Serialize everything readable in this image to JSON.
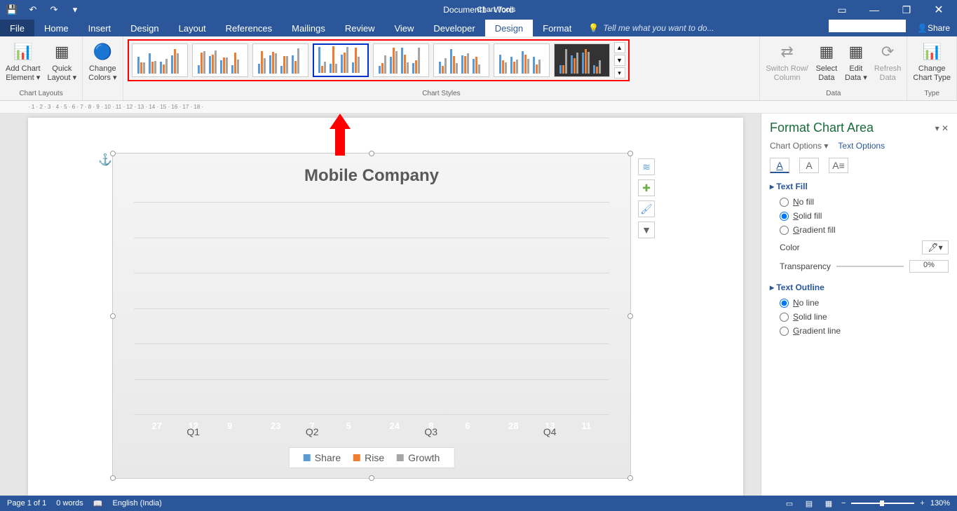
{
  "app": {
    "title": "Document1 - Word",
    "contextTab": "Chart Tools"
  },
  "qat": {
    "save": "💾",
    "undo": "↶",
    "redo": "↷",
    "more": "▾"
  },
  "windowBtns": {
    "ribbonOpts": "▭",
    "min": "—",
    "restore": "❐",
    "close": "✕"
  },
  "tabs": [
    "File",
    "Home",
    "Insert",
    "Design",
    "Layout",
    "References",
    "Mailings",
    "Review",
    "View",
    "Developer",
    "Design",
    "Format"
  ],
  "activeTab": 10,
  "tellme": "Tell me what you want to do...",
  "share": "Share",
  "ribbon": {
    "chartLayouts": {
      "label": "Chart Layouts",
      "addElement": "Add Chart\nElement ▾",
      "quickLayout": "Quick\nLayout ▾"
    },
    "changeColors": "Change\nColors ▾",
    "chartStyles": {
      "label": "Chart Styles"
    },
    "data": {
      "label": "Data",
      "switch": "Switch Row/\nColumn",
      "select": "Select\nData",
      "edit": "Edit\nData ▾",
      "refresh": "Refresh\nData"
    },
    "type": {
      "label": "Type",
      "change": "Change\nChart Type"
    }
  },
  "chart_data": {
    "type": "bar",
    "title": "Mobile Company",
    "categories": [
      "Q1",
      "Q2",
      "Q3",
      "Q4"
    ],
    "series": [
      {
        "name": "Share",
        "values": [
          27,
          23,
          24,
          28
        ]
      },
      {
        "name": "Rise",
        "values": [
          12,
          7,
          8,
          13
        ]
      },
      {
        "name": "Growth",
        "values": [
          9,
          5,
          6,
          11
        ]
      }
    ],
    "ylim": [
      0,
      30
    ]
  },
  "sideButtons": {
    "elements": "≋",
    "add": "✚",
    "style": "🖌",
    "filter": "▼"
  },
  "formatPane": {
    "title": "Format Chart Area",
    "tabChart": "Chart Options ▾",
    "tabText": "Text Options",
    "sectionFill": "Text Fill",
    "noFill": "No fill",
    "solidFill": "Solid fill",
    "gradientFill": "Gradient fill",
    "colorLabel": "Color",
    "transLabel": "Transparency",
    "transValue": "0%",
    "sectionOutline": "Text Outline",
    "noLine": "No line",
    "solidLine": "Solid line",
    "gradientLine": "Gradient line"
  },
  "status": {
    "page": "Page 1 of 1",
    "words": "0 words",
    "lang": "English (India)",
    "zoom": "130%"
  }
}
